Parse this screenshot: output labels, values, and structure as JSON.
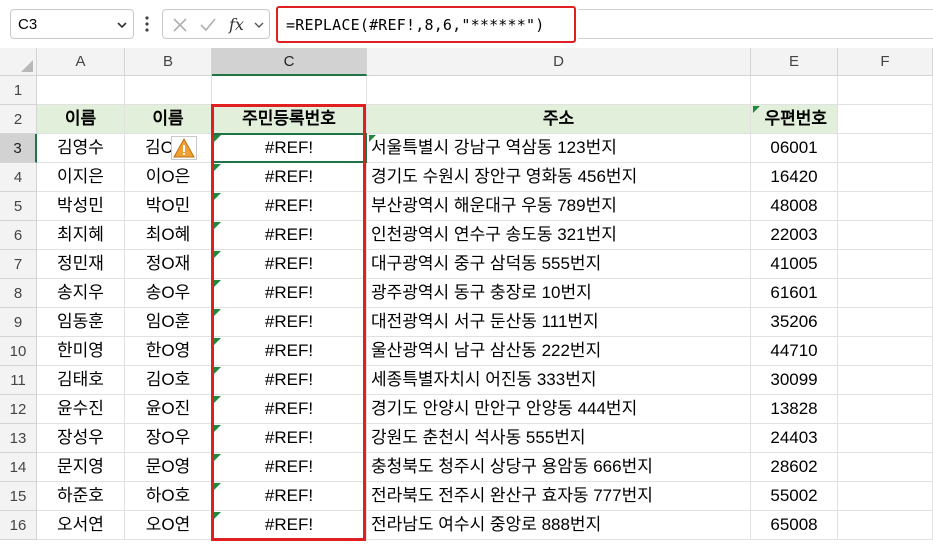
{
  "formula_bar": {
    "name_box": "C3",
    "formula": "=REPLACE(#REF!,8,6,\"******\")"
  },
  "icons": {
    "name_box_dropdown": "chevron-down-icon",
    "more": "vertical-dots-icon",
    "cancel": "cancel-x-icon",
    "enter": "check-icon",
    "function": "fx-icon",
    "fx_dropdown": "chevron-down-icon",
    "error_warning": "warning-icon",
    "select_all": "select-all-triangle-icon"
  },
  "colors": {
    "header_fill": "#e2efda",
    "error_indicator": "#1f8a3c",
    "highlight_box": "#e02020",
    "selection": "#217346"
  },
  "columns": [
    "A",
    "B",
    "C",
    "D",
    "E",
    "F"
  ],
  "row_numbers": [
    "1",
    "2",
    "3",
    "4",
    "5",
    "6",
    "7",
    "8",
    "9",
    "10",
    "11",
    "12",
    "13",
    "14",
    "15",
    "16"
  ],
  "table": {
    "headers": [
      "이름",
      "이름",
      "주민등록번호",
      "주소",
      "우편번호"
    ],
    "rows": [
      {
        "a": "김영수",
        "b": "김C",
        "c": "#REF!",
        "d": "서울특별시 강남구 역삼동 123번지",
        "e": "06001"
      },
      {
        "a": "이지은",
        "b": "이O은",
        "c": "#REF!",
        "d": "경기도 수원시 장안구 영화동 456번지",
        "e": "16420"
      },
      {
        "a": "박성민",
        "b": "박O민",
        "c": "#REF!",
        "d": "부산광역시 해운대구 우동 789번지",
        "e": "48008"
      },
      {
        "a": "최지혜",
        "b": "최O혜",
        "c": "#REF!",
        "d": "인천광역시 연수구 송도동 321번지",
        "e": "22003"
      },
      {
        "a": "정민재",
        "b": "정O재",
        "c": "#REF!",
        "d": "대구광역시 중구 삼덕동 555번지",
        "e": "41005"
      },
      {
        "a": "송지우",
        "b": "송O우",
        "c": "#REF!",
        "d": "광주광역시 동구 충장로 10번지",
        "e": "61601"
      },
      {
        "a": "임동훈",
        "b": "임O훈",
        "c": "#REF!",
        "d": "대전광역시 서구 둔산동 111번지",
        "e": "35206"
      },
      {
        "a": "한미영",
        "b": "한O영",
        "c": "#REF!",
        "d": "울산광역시 남구 삼산동 222번지",
        "e": "44710"
      },
      {
        "a": "김태호",
        "b": "김O호",
        "c": "#REF!",
        "d": "세종특별자치시 어진동 333번지",
        "e": "30099"
      },
      {
        "a": "윤수진",
        "b": "윤O진",
        "c": "#REF!",
        "d": "경기도 안양시 만안구 안양동 444번지",
        "e": "13828"
      },
      {
        "a": "장성우",
        "b": "장O우",
        "c": "#REF!",
        "d": "강원도 춘천시 석사동 555번지",
        "e": "24403"
      },
      {
        "a": "문지영",
        "b": "문O영",
        "c": "#REF!",
        "d": "충청북도 청주시 상당구 용암동 666번지",
        "e": "28602"
      },
      {
        "a": "하준호",
        "b": "하O호",
        "c": "#REF!",
        "d": "전라북도 전주시 완산구 효자동 777번지",
        "e": "55002"
      },
      {
        "a": "오서연",
        "b": "오O연",
        "c": "#REF!",
        "d": "전라남도 여수시 중앙로 888번지",
        "e": "65008"
      }
    ]
  }
}
